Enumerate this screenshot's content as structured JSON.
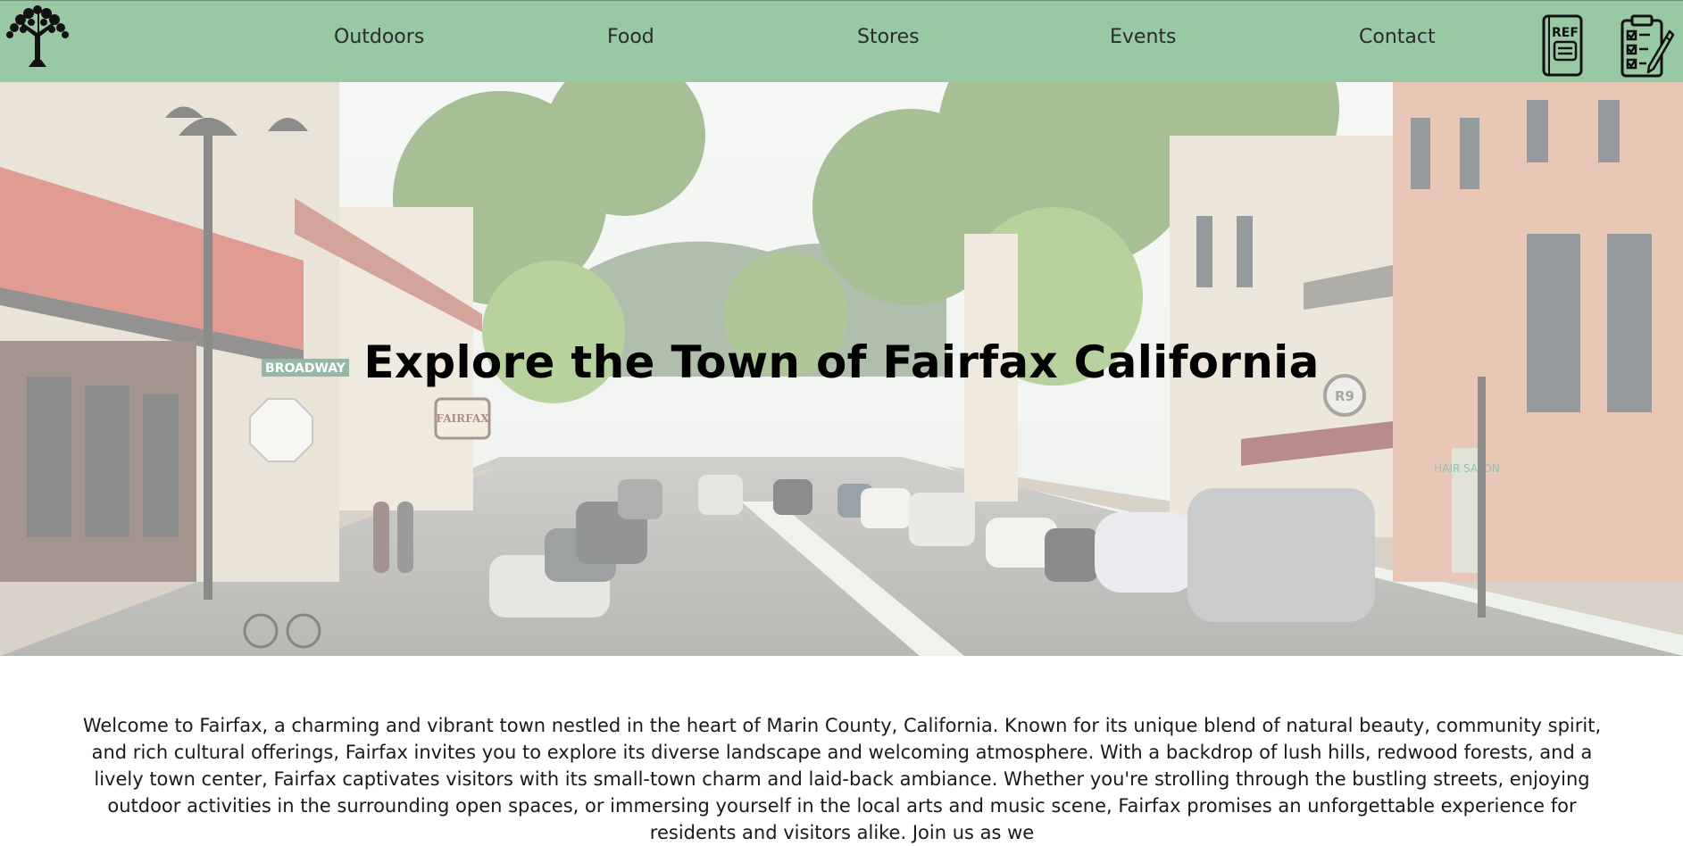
{
  "nav": {
    "links": [
      {
        "label": "Outdoors"
      },
      {
        "label": "Food"
      },
      {
        "label": "Stores"
      },
      {
        "label": "Events"
      },
      {
        "label": "Contact"
      }
    ],
    "icons": {
      "logo": "tree-icon",
      "reference": "ref-book-icon",
      "reference_text": "REF",
      "checklist": "checklist-clipboard-icon"
    },
    "background_color": "#98c9a3"
  },
  "hero": {
    "title": "Explore the Town of Fairfax California",
    "street_sign_text": "BROADWAY",
    "storefront_sign_text": "FAIRFAX",
    "badge_text": "R9",
    "salon_sign_text": "HAIR SALON"
  },
  "intro": {
    "text": "Welcome to Fairfax, a charming and vibrant town nestled in the heart of Marin County, California. Known for its unique blend of natural beauty, community spirit, and rich cultural offerings, Fairfax invites you to explore its diverse landscape and welcoming atmosphere. With a backdrop of lush hills, redwood forests, and a lively town center, Fairfax captivates visitors with its small-town charm and laid-back ambiance. Whether you're strolling through the bustling streets, enjoying outdoor activities in the surrounding open spaces, or immersing yourself in the local arts and music scene, Fairfax promises an unforgettable experience for residents and visitors alike. Join us as we"
  }
}
